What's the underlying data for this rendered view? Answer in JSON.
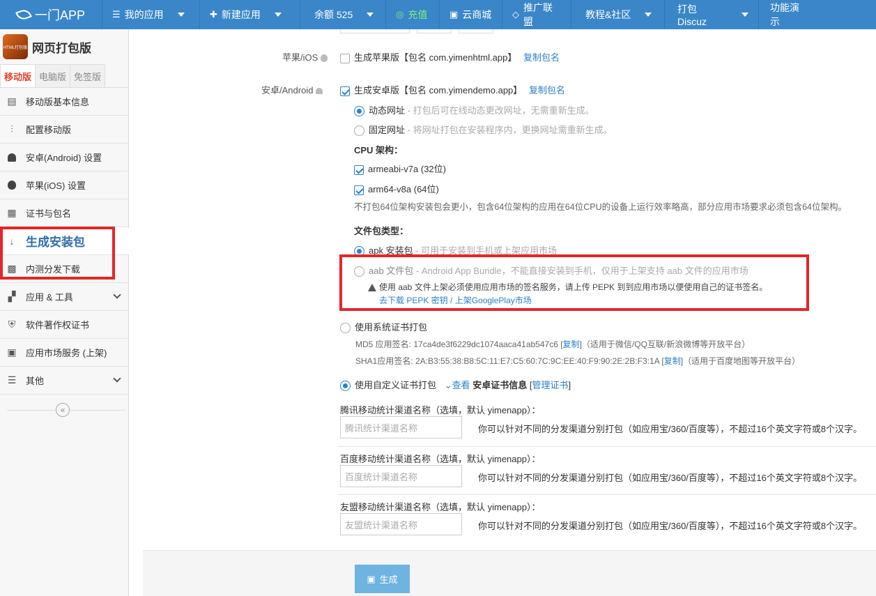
{
  "topnav": {
    "brand": "一门APP",
    "items": [
      {
        "label": "我的应用",
        "icon": "menu-icon"
      },
      {
        "label": "新建应用",
        "icon": "plus-icon"
      },
      {
        "label": "余额 525",
        "icon": ""
      },
      {
        "label": "充值",
        "icon": "recharge-icon"
      },
      {
        "label": "云商城",
        "icon": "cart-icon"
      },
      {
        "label": "推广联盟",
        "icon": "diamond-icon"
      },
      {
        "label": "教程&社区",
        "icon": ""
      },
      {
        "label": "打包 Discuz",
        "icon": ""
      },
      {
        "label": "功能演示",
        "icon": ""
      }
    ]
  },
  "sidebar": {
    "app_name": "网页打包版",
    "app_logo_text": "HTML打包版",
    "version_tabs": [
      "移动版",
      "电脑版",
      "免签版"
    ],
    "items": [
      {
        "label": "移动版基本信息",
        "icon": "document-icon"
      },
      {
        "label": "配置移动版",
        "icon": "sliders-icon"
      },
      {
        "label": "安卓(Android) 设置",
        "icon": "android-icon"
      },
      {
        "label": "苹果(iOS) 设置",
        "icon": "apple-icon"
      },
      {
        "label": "证书与包名",
        "icon": "certificate-icon"
      },
      {
        "label": "生成安装包",
        "icon": "sort-numeric-icon"
      },
      {
        "label": "内测分发下载",
        "icon": "qrcode-icon"
      },
      {
        "label": "应用 & 工具",
        "icon": "apps-icon"
      },
      {
        "label": "软件著作权证书",
        "icon": "shield-icon"
      },
      {
        "label": "应用市场服务 (上架)",
        "icon": "store-icon"
      },
      {
        "label": "其他",
        "icon": "bars-icon"
      }
    ],
    "collapse_glyph": "«"
  },
  "main": {
    "ios": {
      "label": "苹果/iOS",
      "option": "生成苹果版【包名 com.yimenhtml.app】",
      "copy": "复制包名"
    },
    "android": {
      "label": "安卓/Android",
      "option": "生成安卓版【包名 com.yimendemo.app】",
      "copy": "复制包名",
      "url_mode": [
        {
          "title": "动态网址",
          "desc": " - 打包后可在线动态更改网址，无需重新生成。"
        },
        {
          "title": "固定网址",
          "desc": " - 将网址打包在安装程序内，更换网址需重新生成。"
        }
      ],
      "cpu_title": "CPU 架构：",
      "cpu": [
        "armeabi-v7a (32位)",
        "arm64-v8a (64位)"
      ],
      "cpu_hint": "不打包64位架构安装包会更小，包含64位架构的应用在64位CPU的设备上运行效率略高，部分应用市场要求必须包含64位架构。",
      "filetype_title": "文件包类型：",
      "apk": {
        "title": "apk 安装包",
        "desc": " - 可用于安装到手机或上架应用市场"
      },
      "aab": {
        "title": "aab 文件包",
        "desc": " - Android App Bundle，不能直接安装到手机，仅用于上架支持 aab 文件的应用市场"
      },
      "aab_warn": "使用 aab 文件上架必须使用应用市场的签名服务，请上传 PEPK 到到应用市场以便使用自己的证书签名。",
      "aab_links": [
        "去下载 PEPK 密钥",
        "上架GooglePlay市场"
      ],
      "aab_link_sep": " / ",
      "sys_cert": "使用系统证书打包",
      "md5_label": "MD5 应用签名: ",
      "md5_value": "17ca4de3f6229dc1074aaca41ab547c6",
      "md5_copy": "复制",
      "md5_note": "（适用于微信/QQ互联/新浪微博等开放平台）",
      "sha1_label": "SHA1应用签名: ",
      "sha1_value": "2A:B3:55:38:B8:5C:11:E7:C5:60:7C:9C:EE:40:F9:90:2E:2B:F3:1A",
      "sha1_copy": "复制",
      "sha1_note": "（适用于百度地图等开放平台）",
      "custom_cert": "使用自定义证书打包",
      "view_link": "查看",
      "cert_info": "安卓证书信息",
      "manage_cert": "管理证书"
    },
    "channels": [
      {
        "label": "腾讯移动统计渠道名称（选填，默认 yimenapp）：",
        "placeholder": "腾讯统计渠道名称",
        "hint": "你可以针对不同的分发渠道分别打包（如应用宝/360/百度等），不超过16个英文字符或8个汉字。"
      },
      {
        "label": "百度移动统计渠道名称（选填，默认 yimenapp）：",
        "placeholder": "百度统计渠道名称",
        "hint": "你可以针对不同的分发渠道分别打包（如应用宝/360/百度等），不超过16个英文字符或8个汉字。"
      },
      {
        "label": "友盟移动统计渠道名称（选填，默认 yimenapp）：",
        "placeholder": "友盟统计渠道名称",
        "hint": "你可以针对不同的分发渠道分别打包（如应用宝/360/百度等），不超过16个英文字符或8个汉字。"
      }
    ],
    "generate_button": "生成"
  },
  "colors": {
    "nav": "#3a86c8",
    "link": "#2a80c9",
    "highlight": "#e3262b",
    "button": "#6fb3e0"
  }
}
